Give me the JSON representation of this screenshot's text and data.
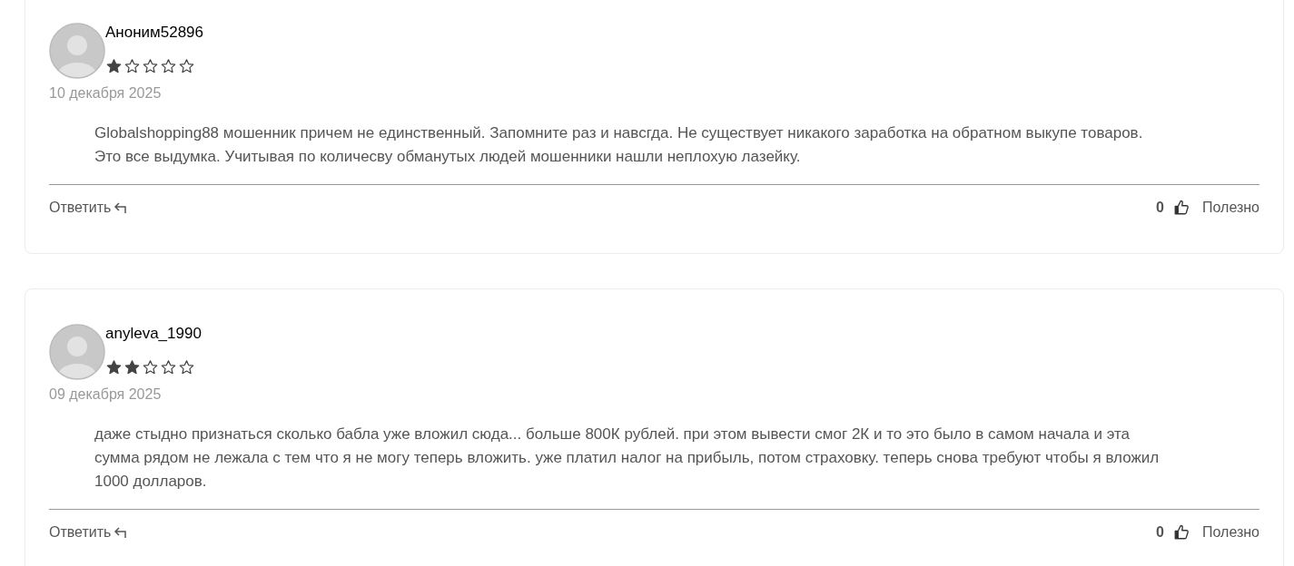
{
  "reviews": [
    {
      "author": "Аноним52896",
      "stars": 1,
      "date": "10 декабря 2025",
      "text": "Globalshopping88 мошенник причем не единственный. Запомните раз и навсгда. Не существует никакого заработка на обратном выкупе товаров. Это все выдумка. Учитывая по количесву обманутых людей мошенники нашли неплохую лазейку.",
      "reply": "Ответить",
      "likes": "0",
      "useful": "Полезно"
    },
    {
      "author": "anyleva_1990",
      "stars": 2,
      "date": "09 декабря 2025",
      "text": "даже стыдно признаться сколько бабла уже вложил сюда... больше 800К рублей. при этом вывести смог 2К и то это было в самом начала и эта сумма рядом не лежала с тем что я не могу теперь вложить. уже платил налог на прибыль, потом страховку. теперь снова требуют чтобы я вложил 1000 долларов.",
      "reply": "Ответить",
      "likes": "0",
      "useful": "Полезно"
    }
  ]
}
